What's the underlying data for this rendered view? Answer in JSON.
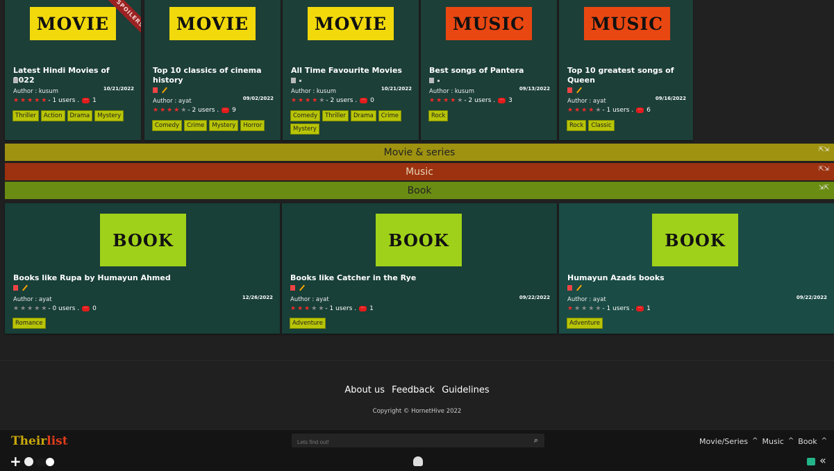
{
  "top_cards": [
    {
      "thumb": "MOVIE",
      "ribbon": "SPOILERS",
      "title": "Latest Hindi Movies of 2022",
      "author": "Author : kusum",
      "date": "10/21/2022",
      "stars": 5,
      "users": "- 1 users .",
      "comments": "1",
      "tags": [
        "Thriller",
        "Action",
        "Drama",
        "Mystery"
      ]
    },
    {
      "thumb": "MOVIE",
      "title": "Top 10 classics of cinema history",
      "author": "Author : ayat",
      "date": "09/02/2022",
      "stars": 4,
      "users": "- 2 users .",
      "comments": "9",
      "tags": [
        "Comedy",
        "Crime",
        "Mystery",
        "Horror"
      ]
    },
    {
      "thumb": "MOVIE",
      "title": "All Time Favourite Movies",
      "author": "Author : kusum",
      "date": "10/21/2022",
      "stars": 4,
      "users": "- 2 users .",
      "comments": "0",
      "tags": [
        "Comedy",
        "Thriller",
        "Drama",
        "Crime",
        "Mystery"
      ]
    },
    {
      "thumb": "MUSIC",
      "title": "Best songs of Pantera",
      "author": "Author : kusum",
      "date": "09/13/2022",
      "stars": 4,
      "users": "- 2 users .",
      "comments": "3",
      "tags": [
        "Rock"
      ]
    },
    {
      "thumb": "MUSIC",
      "title": "Top 10 greatest songs of Queen",
      "author": "Author : ayat",
      "date": "09/16/2022",
      "stars": 4,
      "users": "- 1 users .",
      "comments": "6",
      "tags": [
        "Rock",
        "Classic"
      ]
    }
  ],
  "sections": [
    {
      "label": "Movie & series",
      "color": "#9e9210"
    },
    {
      "label": "Music",
      "color": "#9c3210"
    },
    {
      "label": "Book",
      "color": "#6a8c12"
    }
  ],
  "book_cards": [
    {
      "thumb": "BOOK",
      "title": "Books like Rupa by Humayun Ahmed",
      "author": "Author : ayat",
      "date": "12/26/2022",
      "stars": 0,
      "users": "- 0 users .",
      "comments": "0",
      "tags": [
        "Romance"
      ]
    },
    {
      "thumb": "BOOK",
      "title": "Books like Catcher in the Rye",
      "author": "Author : ayat",
      "date": "09/22/2022",
      "stars": 3,
      "users": "- 1 users .",
      "comments": "1",
      "tags": [
        "Adventure"
      ]
    },
    {
      "thumb": "BOOK",
      "title": "Humayun Azads books",
      "author": "Author : ayat",
      "date": "09/22/2022",
      "stars": 1,
      "users": "- 1 users .",
      "comments": "1",
      "tags": [
        "Adventure"
      ]
    }
  ],
  "footer": {
    "links": [
      "About us",
      "Feedback",
      "Guidelines"
    ],
    "copyright": "Copyright © HornetHive 2022"
  },
  "navbar": {
    "logo_a": "Their",
    "logo_b": "list",
    "search_placeholder": "Lets find out!",
    "categories": [
      "Movie/Series",
      "Music",
      "Book"
    ]
  }
}
